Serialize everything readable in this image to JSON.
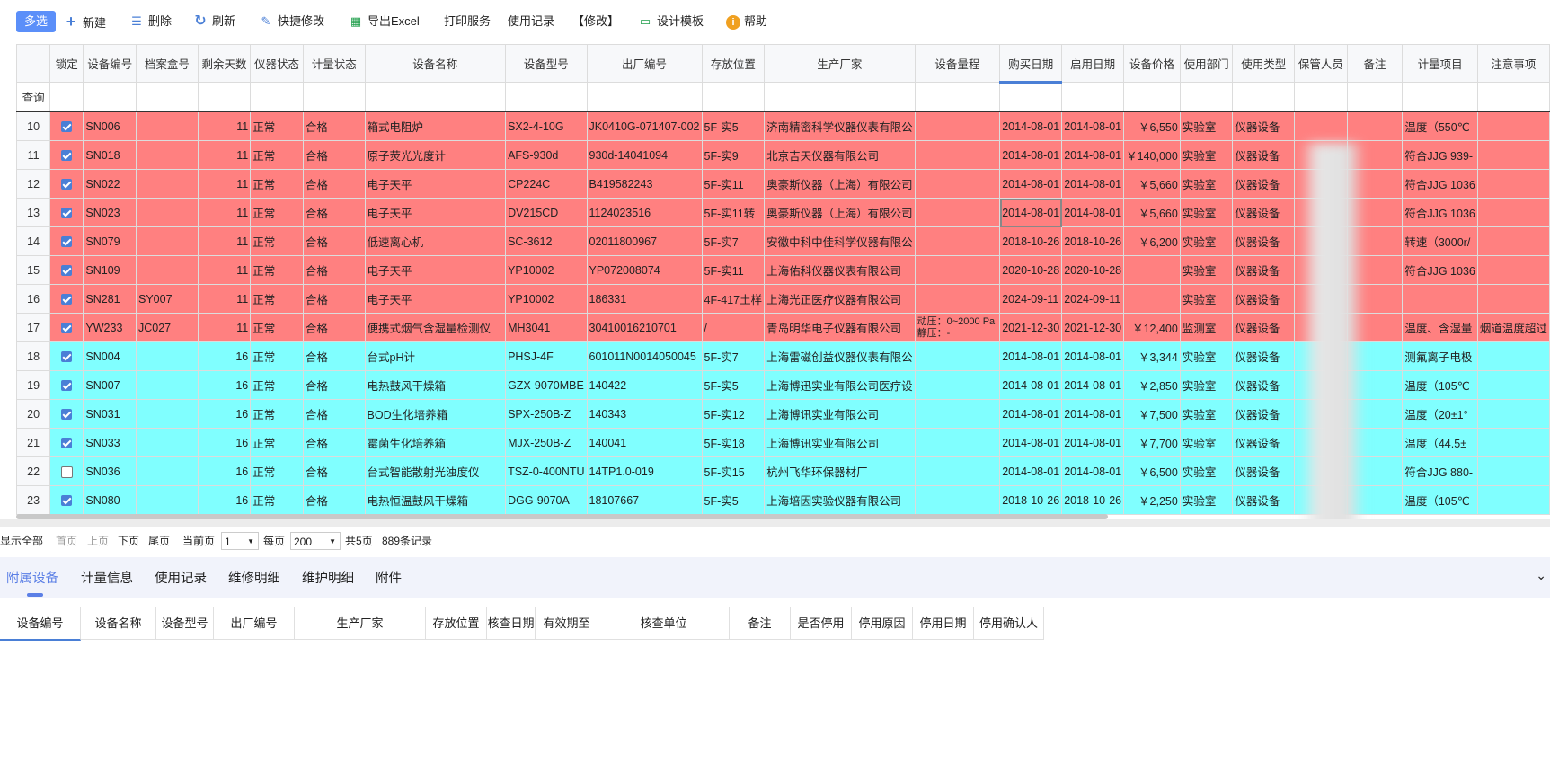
{
  "toolbar": {
    "multi_select": "多选",
    "new": "新建",
    "delete": "删除",
    "refresh": "刷新",
    "quick_edit": "快捷修改",
    "export_excel": "导出Excel",
    "print_service": "打印服务",
    "usage_record": "使用记录",
    "modify": "【修改】",
    "design_template": "设计模板",
    "help": "帮助"
  },
  "grid": {
    "columns": [
      "锁定",
      "设备编号",
      "档案盒号",
      "剩余天数",
      "仪器状态",
      "计量状态",
      "设备名称",
      "设备型号",
      "出厂编号",
      "存放位置",
      "生产厂家",
      "设备量程",
      "购买日期",
      "启用日期",
      "设备价格",
      "使用部门",
      "使用类型",
      "保管人员",
      "备注",
      "计量项目",
      "注意事项"
    ],
    "query_label": "查询",
    "rows": [
      {
        "no": "10",
        "locked": true,
        "code": "SN006",
        "box": "",
        "days": "11",
        "status": "正常",
        "metro": "合格",
        "name": "箱式电阻炉",
        "model": "SX2-4-10G",
        "serial": "JK0410G-071407-002",
        "loc": "5F-实5",
        "maker": "济南精密科学仪器仪表有限公",
        "range": "",
        "buy": "2014-08-01",
        "start": "2014-08-01",
        "price": "￥6,550",
        "dept": "实验室",
        "type": "仪器设备",
        "keeper": "",
        "note": "",
        "item": "温度（550℃",
        "caution": "",
        "color": "red"
      },
      {
        "no": "11",
        "locked": true,
        "code": "SN018",
        "box": "",
        "days": "11",
        "status": "正常",
        "metro": "合格",
        "name": "原子荧光光度计",
        "model": "AFS-930d",
        "serial": "930d-14041094",
        "loc": "5F-实9",
        "maker": "北京吉天仪器有限公司",
        "range": "",
        "buy": "2014-08-01",
        "start": "2014-08-01",
        "price": "￥140,000",
        "dept": "实验室",
        "type": "仪器设备",
        "keeper": "",
        "note": "",
        "item": "符合JJG 939-",
        "caution": "",
        "color": "red"
      },
      {
        "no": "12",
        "locked": true,
        "code": "SN022",
        "box": "",
        "days": "11",
        "status": "正常",
        "metro": "合格",
        "name": "电子天平",
        "model": "CP224C",
        "serial": "B419582243",
        "loc": "5F-实11",
        "maker": "奥豪斯仪器（上海）有限公司",
        "range": "",
        "buy": "2014-08-01",
        "start": "2014-08-01",
        "price": "￥5,660",
        "dept": "实验室",
        "type": "仪器设备",
        "keeper": "",
        "note": "",
        "item": "符合JJG 1036",
        "caution": "",
        "color": "red"
      },
      {
        "no": "13",
        "locked": true,
        "code": "SN023",
        "box": "",
        "days": "11",
        "status": "正常",
        "metro": "合格",
        "name": "电子天平",
        "model": "DV215CD",
        "serial": "1124023516",
        "loc": "5F-实11转",
        "maker": "奥豪斯仪器（上海）有限公司",
        "range": "",
        "buy": "2014-08-01",
        "start": "2014-08-01",
        "price": "￥5,660",
        "dept": "实验室",
        "type": "仪器设备",
        "keeper": "",
        "note": "",
        "item": "符合JJG 1036",
        "caution": "",
        "color": "red"
      },
      {
        "no": "14",
        "locked": true,
        "code": "SN079",
        "box": "",
        "days": "11",
        "status": "正常",
        "metro": "合格",
        "name": "低速离心机",
        "model": "SC-3612",
        "serial": "02011800967",
        "loc": "5F-实7",
        "maker": "安徽中科中佳科学仪器有限公",
        "range": "",
        "buy": "2018-10-26",
        "start": "2018-10-26",
        "price": "￥6,200",
        "dept": "实验室",
        "type": "仪器设备",
        "keeper": "",
        "note": "",
        "item": "转速（3000r/",
        "caution": "",
        "color": "red"
      },
      {
        "no": "15",
        "locked": true,
        "code": "SN109",
        "box": "",
        "days": "11",
        "status": "正常",
        "metro": "合格",
        "name": "电子天平",
        "model": "YP10002",
        "serial": "YP072008074",
        "loc": "5F-实11",
        "maker": "上海佑科仪器仪表有限公司",
        "range": "",
        "buy": "2020-10-28",
        "start": "2020-10-28",
        "price": "",
        "dept": "实验室",
        "type": "仪器设备",
        "keeper": "",
        "note": "",
        "item": "符合JJG 1036",
        "caution": "",
        "color": "red"
      },
      {
        "no": "16",
        "locked": true,
        "code": "SN281",
        "box": "SY007",
        "days": "11",
        "status": "正常",
        "metro": "合格",
        "name": "电子天平",
        "model": "YP10002",
        "serial": "186331",
        "loc": "4F-417土样",
        "maker": "上海光正医疗仪器有限公司",
        "range": "",
        "buy": "2024-09-11",
        "start": "2024-09-11",
        "price": "",
        "dept": "实验室",
        "type": "仪器设备",
        "keeper": "",
        "note": "",
        "item": "",
        "caution": "",
        "color": "red"
      },
      {
        "no": "17",
        "locked": true,
        "code": "YW233",
        "box": "JC027",
        "days": "11",
        "status": "正常",
        "metro": "合格",
        "name": "便携式烟气含湿量检测仪",
        "model": "MH3041",
        "serial": "30410016210701",
        "loc": "/",
        "maker": "青岛明华电子仪器有限公司",
        "range": "动压：0~2000 Pa 静压：-",
        "buy": "2021-12-30",
        "start": "2021-12-30",
        "price": "￥12,400",
        "dept": "监测室",
        "type": "仪器设备",
        "keeper": "",
        "note": "",
        "item": "温度、含湿量",
        "caution": "烟道温度超过",
        "color": "red"
      },
      {
        "no": "18",
        "locked": true,
        "code": "SN004",
        "box": "",
        "days": "16",
        "status": "正常",
        "metro": "合格",
        "name": "台式pH计",
        "model": "PHSJ-4F",
        "serial": "601011N0014050045",
        "loc": "5F-实7",
        "maker": "上海雷磁创益仪器仪表有限公",
        "range": "",
        "buy": "2014-08-01",
        "start": "2014-08-01",
        "price": "￥3,344",
        "dept": "实验室",
        "type": "仪器设备",
        "keeper": "",
        "note": "",
        "item": "测氟离子电极",
        "caution": "",
        "color": "cyan"
      },
      {
        "no": "19",
        "locked": true,
        "code": "SN007",
        "box": "",
        "days": "16",
        "status": "正常",
        "metro": "合格",
        "name": "电热鼓风干燥箱",
        "model": "GZX-9070MBE",
        "serial": "140422",
        "loc": "5F-实5",
        "maker": "上海博迅实业有限公司医疗设",
        "range": "",
        "buy": "2014-08-01",
        "start": "2014-08-01",
        "price": "￥2,850",
        "dept": "实验室",
        "type": "仪器设备",
        "keeper": "",
        "note": "",
        "item": "温度（105℃",
        "caution": "",
        "color": "cyan"
      },
      {
        "no": "20",
        "locked": true,
        "code": "SN031",
        "box": "",
        "days": "16",
        "status": "正常",
        "metro": "合格",
        "name": "BOD生化培养箱",
        "model": "SPX-250B-Z",
        "serial": "140343",
        "loc": "5F-实12",
        "maker": "上海博讯实业有限公司",
        "range": "",
        "buy": "2014-08-01",
        "start": "2014-08-01",
        "price": "￥7,500",
        "dept": "实验室",
        "type": "仪器设备",
        "keeper": "",
        "note": "",
        "item": "温度（20±1°",
        "caution": "",
        "color": "cyan"
      },
      {
        "no": "21",
        "locked": true,
        "code": "SN033",
        "box": "",
        "days": "16",
        "status": "正常",
        "metro": "合格",
        "name": "霉菌生化培养箱",
        "model": "MJX-250B-Z",
        "serial": "140041",
        "loc": "5F-实18",
        "maker": "上海博讯实业有限公司",
        "range": "",
        "buy": "2014-08-01",
        "start": "2014-08-01",
        "price": "￥7,700",
        "dept": "实验室",
        "type": "仪器设备",
        "keeper": "",
        "note": "",
        "item": "温度（44.5±",
        "caution": "",
        "color": "cyan"
      },
      {
        "no": "22",
        "locked": false,
        "code": "SN036",
        "box": "",
        "days": "16",
        "status": "正常",
        "metro": "合格",
        "name": "台式智能散射光浊度仪",
        "model": "TSZ-0-400NTU",
        "serial": "14TP1.0-019",
        "loc": "5F-实15",
        "maker": "杭州飞华环保器材厂",
        "range": "",
        "buy": "2014-08-01",
        "start": "2014-08-01",
        "price": "￥6,500",
        "dept": "实验室",
        "type": "仪器设备",
        "keeper": "",
        "note": "",
        "item": "符合JJG 880-",
        "caution": "",
        "color": "cyan"
      },
      {
        "no": "23",
        "locked": true,
        "code": "SN080",
        "box": "",
        "days": "16",
        "status": "正常",
        "metro": "合格",
        "name": "电热恒温鼓风干燥箱",
        "model": "DGG-9070A",
        "serial": "18107667",
        "loc": "5F-实5",
        "maker": "上海培因实验仪器有限公司",
        "range": "",
        "buy": "2018-10-26",
        "start": "2018-10-26",
        "price": "￥2,250",
        "dept": "实验室",
        "type": "仪器设备",
        "keeper": "",
        "note": "",
        "item": "温度（105℃",
        "caution": "",
        "color": "cyan"
      }
    ]
  },
  "pager": {
    "show_all": "显示全部",
    "first": "首页",
    "prev": "上页",
    "next": "下页",
    "last": "尾页",
    "current_label": "当前页",
    "current_page": "1",
    "per_page_label": "每页",
    "per_page": "200",
    "total_pages": "共5页",
    "total_records": "889条记录"
  },
  "detail_tabs": [
    "附属设备",
    "计量信息",
    "使用记录",
    "维修明细",
    "维护明细",
    "附件"
  ],
  "sub_columns": [
    "设备编号",
    "设备名称",
    "设备型号",
    "出厂编号",
    "生产厂家",
    "存放位置",
    "核查日期",
    "有效期至",
    "核查单位",
    "备注",
    "是否停用",
    "停用原因",
    "停用日期",
    "停用确认人"
  ],
  "colors": {
    "primary": "#5b8ff9",
    "red_row": "#ff8080",
    "cyan_row": "#80ffff",
    "accent": "#5b7fe6"
  }
}
